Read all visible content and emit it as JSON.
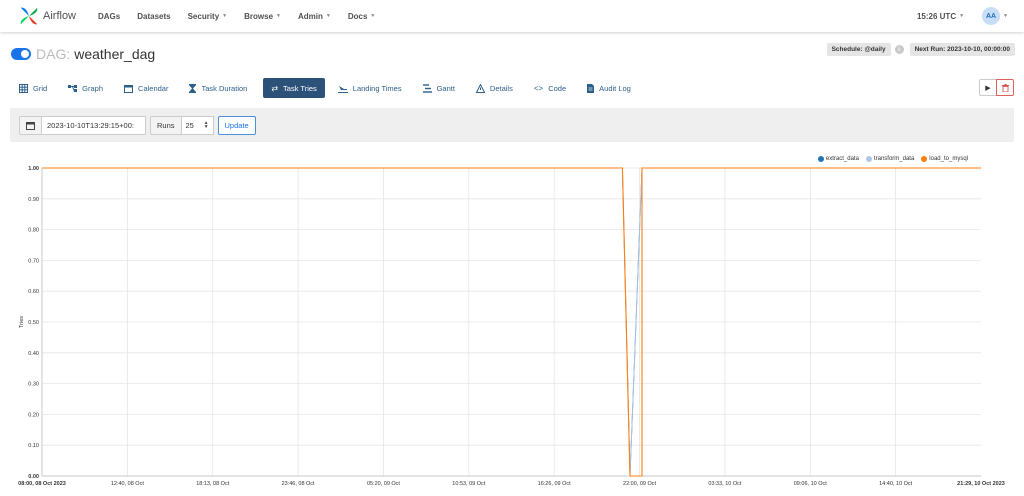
{
  "nav": {
    "brand": "Airflow",
    "menu": [
      {
        "label": "DAGs",
        "dropdown": false
      },
      {
        "label": "Datasets",
        "dropdown": false
      },
      {
        "label": "Security",
        "dropdown": true
      },
      {
        "label": "Browse",
        "dropdown": true
      },
      {
        "label": "Admin",
        "dropdown": true
      },
      {
        "label": "Docs",
        "dropdown": true
      }
    ],
    "time": "15:26 UTC",
    "avatar": "AA"
  },
  "dag": {
    "prefix": "DAG:",
    "name": "weather_dag",
    "paused": false,
    "schedule": "Schedule: @daily",
    "next_run": "Next Run: 2023-10-10, 00:00:00"
  },
  "tabs": [
    {
      "label": "Grid",
      "icon": "grid-icon",
      "active": false
    },
    {
      "label": "Graph",
      "icon": "graph-icon",
      "active": false
    },
    {
      "label": "Calendar",
      "icon": "calendar-icon",
      "active": false
    },
    {
      "label": "Task Duration",
      "icon": "hourglass-icon",
      "active": false
    },
    {
      "label": "Task Tries",
      "icon": "retry-icon",
      "active": true
    },
    {
      "label": "Landing Times",
      "icon": "landing-icon",
      "active": false
    },
    {
      "label": "Gantt",
      "icon": "gantt-icon",
      "active": false
    },
    {
      "label": "Details",
      "icon": "warning-icon",
      "active": false
    },
    {
      "label": "Code",
      "icon": "code-icon",
      "active": false
    },
    {
      "label": "Audit Log",
      "icon": "file-icon",
      "active": false
    }
  ],
  "filter": {
    "date": "2023-10-10T13:29:15+00:",
    "runs_label": "Runs",
    "runs_value": "25",
    "update_label": "Update"
  },
  "colors": {
    "extract_data": "#1f77b4",
    "transform_data": "#aec7e8",
    "load_to_mysql": "#ff7f0e",
    "active_tab": "#2d5279"
  },
  "chart_data": {
    "type": "line",
    "ylabel": "Tries",
    "ylim": [
      0,
      1
    ],
    "yticks": [
      "0.00",
      "0.10",
      "0.20",
      "0.30",
      "0.40",
      "0.50",
      "0.60",
      "0.70",
      "0.80",
      "0.90",
      "1.00"
    ],
    "xticks": [
      "08:00, 08 Oct 2023",
      "12:40, 08 Oct",
      "18:13, 08 Oct",
      "23:46, 08 Oct",
      "05:20, 09 Oct",
      "10:53, 09 Oct",
      "16:26, 09 Oct",
      "22:00, 09 Oct",
      "03:33, 10 Oct",
      "09:06, 10 Oct",
      "14:40, 10 Oct",
      "21:29, 10 Oct 2023"
    ],
    "xrange": [
      "2023-10-08T08:00",
      "2023-10-10T21:29"
    ],
    "series": [
      {
        "name": "extract_data",
        "points": [
          [
            "2023-10-08T08:00",
            1
          ],
          [
            "2023-10-09T22:00",
            1
          ],
          [
            "2023-10-09T22:30",
            0
          ],
          [
            "2023-10-09T23:17",
            1
          ],
          [
            "2023-10-10T21:29",
            1
          ]
        ]
      },
      {
        "name": "transform_data",
        "points": [
          [
            "2023-10-08T08:00",
            1
          ],
          [
            "2023-10-09T22:00",
            1
          ],
          [
            "2023-10-09T22:30",
            0
          ],
          [
            "2023-10-09T23:17",
            1
          ],
          [
            "2023-10-10T21:29",
            1
          ]
        ]
      },
      {
        "name": "load_to_mysql",
        "points": [
          [
            "2023-10-08T08:00",
            1
          ],
          [
            "2023-10-09T22:00",
            1
          ],
          [
            "2023-10-09T22:30",
            0
          ],
          [
            "2023-10-09T23:17",
            0
          ],
          [
            "2023-10-09T23:17",
            1
          ],
          [
            "2023-10-10T21:29",
            1
          ]
        ]
      }
    ],
    "grid": true,
    "legend_position": "top-right"
  }
}
